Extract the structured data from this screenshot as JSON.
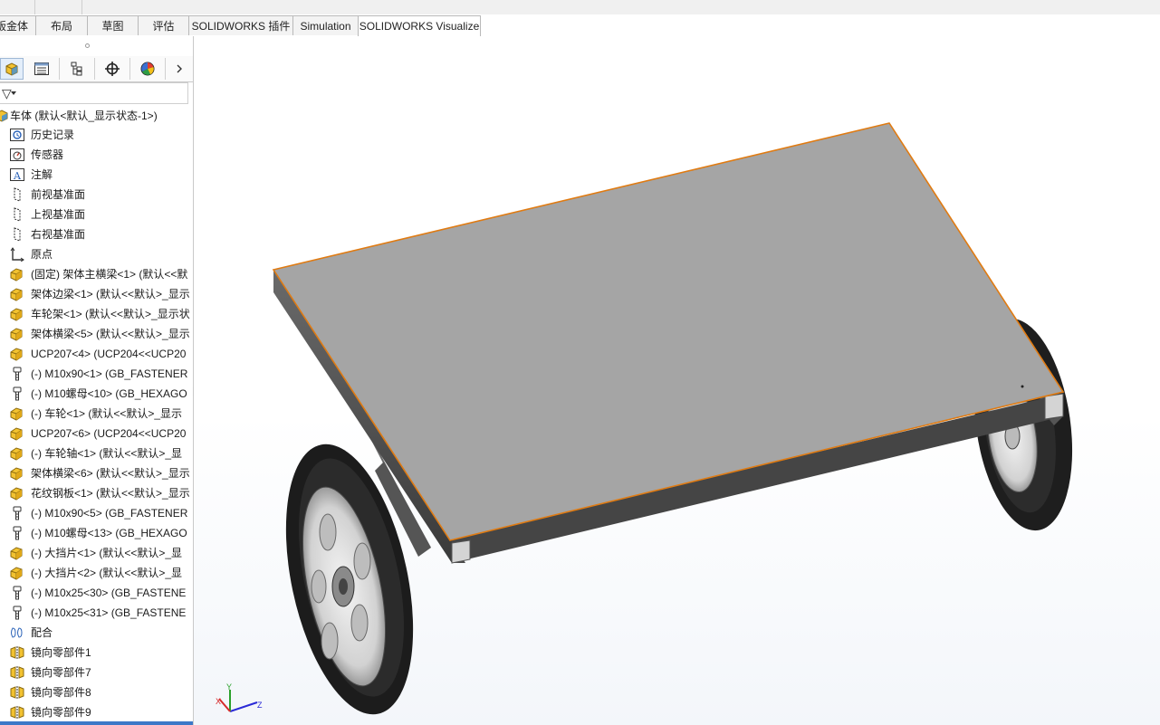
{
  "tabs": [
    {
      "label": "钣金体",
      "active": false
    },
    {
      "label": "布局",
      "active": false
    },
    {
      "label": "草图",
      "active": false
    },
    {
      "label": "评估",
      "active": false
    },
    {
      "label": "SOLIDWORKS 插件",
      "active": false
    },
    {
      "label": "Simulation",
      "active": false
    },
    {
      "label": "SOLIDWORKS Visualize",
      "active": true
    }
  ],
  "feature_manager": {
    "panel_tabs": [
      "feature-manager-tree",
      "property-manager",
      "configuration-manager",
      "dimxpert-manager",
      "display-manager"
    ],
    "root": "车体  (默认<默认_显示状态-1>)",
    "items": [
      {
        "label": "历史记录",
        "icon": "history-icon"
      },
      {
        "label": "传感器",
        "icon": "sensor-icon"
      },
      {
        "label": "注解",
        "icon": "annotation-icon"
      },
      {
        "label": "前视基准面",
        "icon": "plane-icon"
      },
      {
        "label": "上视基准面",
        "icon": "plane-icon"
      },
      {
        "label": "右视基准面",
        "icon": "plane-icon"
      },
      {
        "label": "原点",
        "icon": "origin-icon"
      },
      {
        "label": "(固定) 架体主横梁<1> (默认<<默",
        "icon": "part-icon"
      },
      {
        "label": "架体边梁<1> (默认<<默认>_显示",
        "icon": "part-icon"
      },
      {
        "label": "车轮架<1> (默认<<默认>_显示状",
        "icon": "part-icon"
      },
      {
        "label": "架体横梁<5> (默认<<默认>_显示",
        "icon": "part-icon"
      },
      {
        "label": "UCP207<4> (UCP204<<UCP20",
        "icon": "part-icon"
      },
      {
        "label": "(-) M10x90<1> (GB_FASTENER",
        "icon": "bolt-icon"
      },
      {
        "label": "(-) M10螺母<10> (GB_HEXAGO",
        "icon": "bolt-icon"
      },
      {
        "label": "(-) 车轮<1> (默认<<默认>_显示",
        "icon": "part-icon"
      },
      {
        "label": "UCP207<6> (UCP204<<UCP20",
        "icon": "part-icon"
      },
      {
        "label": "(-) 车轮轴<1> (默认<<默认>_显",
        "icon": "part-icon"
      },
      {
        "label": "架体横梁<6> (默认<<默认>_显示",
        "icon": "part-icon"
      },
      {
        "label": "花纹钢板<1> (默认<<默认>_显示",
        "icon": "part-icon"
      },
      {
        "label": "(-) M10x90<5> (GB_FASTENER",
        "icon": "bolt-icon"
      },
      {
        "label": "(-) M10螺母<13> (GB_HEXAGO",
        "icon": "bolt-icon"
      },
      {
        "label": "(-) 大挡片<1> (默认<<默认>_显",
        "icon": "part-icon"
      },
      {
        "label": "(-) 大挡片<2> (默认<<默认>_显",
        "icon": "part-icon"
      },
      {
        "label": "(-) M10x25<30> (GB_FASTENE",
        "icon": "bolt-icon"
      },
      {
        "label": "(-) M10x25<31> (GB_FASTENE",
        "icon": "bolt-icon"
      },
      {
        "label": "配合",
        "icon": "mates-icon"
      },
      {
        "label": "镜向零部件1",
        "icon": "mirror-component-icon"
      },
      {
        "label": "镜向零部件7",
        "icon": "mirror-component-icon"
      },
      {
        "label": "镜向零部件8",
        "icon": "mirror-component-icon"
      },
      {
        "label": "镜向零部件9",
        "icon": "mirror-component-icon"
      }
    ]
  },
  "heads_up_toolbar": [
    "zoom-to-fit-icon",
    "zoom-to-area-icon",
    "previous-view-icon",
    "section-view-icon",
    "dynamic-annotation-view-icon",
    "view-orientation-icon",
    "display-style-icon",
    "hide-show-items-icon",
    "edit-appearance-icon",
    "apply-scene-icon",
    "view-settings-icon"
  ],
  "triad": {
    "x": "X",
    "y": "Y",
    "z": "Z"
  },
  "colors": {
    "accent": "#3c78c8",
    "plate": "#a4a4a4",
    "plate_edge": "#e07b12",
    "frame": "#5a5a5a",
    "tire": "#2a2a2a",
    "part_icon": "#f0c020"
  }
}
